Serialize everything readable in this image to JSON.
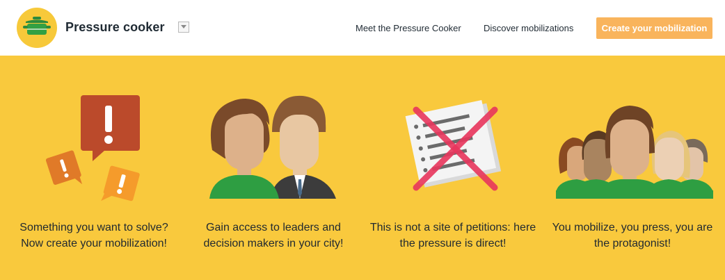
{
  "header": {
    "brand": "Pressure cooker",
    "nav": {
      "meet": "Meet the Pressure Cooker",
      "discover": "Discover mobilizations"
    },
    "cta": "Create your mobilization"
  },
  "features": [
    {
      "icon": "speech-bubbles-exclamation-icon",
      "text": "Something you want to solve? Now create your mobilization!"
    },
    {
      "icon": "two-people-icon",
      "text": "Gain access to leaders and decision makers in your city!"
    },
    {
      "icon": "crossed-out-petition-icon",
      "text": "This is not a site of petitions: here the pressure is direct!"
    },
    {
      "icon": "crowd-icon",
      "text": "You mobilize, you press, you are the protagonist!"
    }
  ],
  "colors": {
    "hero_background": "#f9c93d",
    "cta_background": "#f9b45c",
    "logo_background": "#f7c93a",
    "shirt_green": "#2e9e42"
  }
}
